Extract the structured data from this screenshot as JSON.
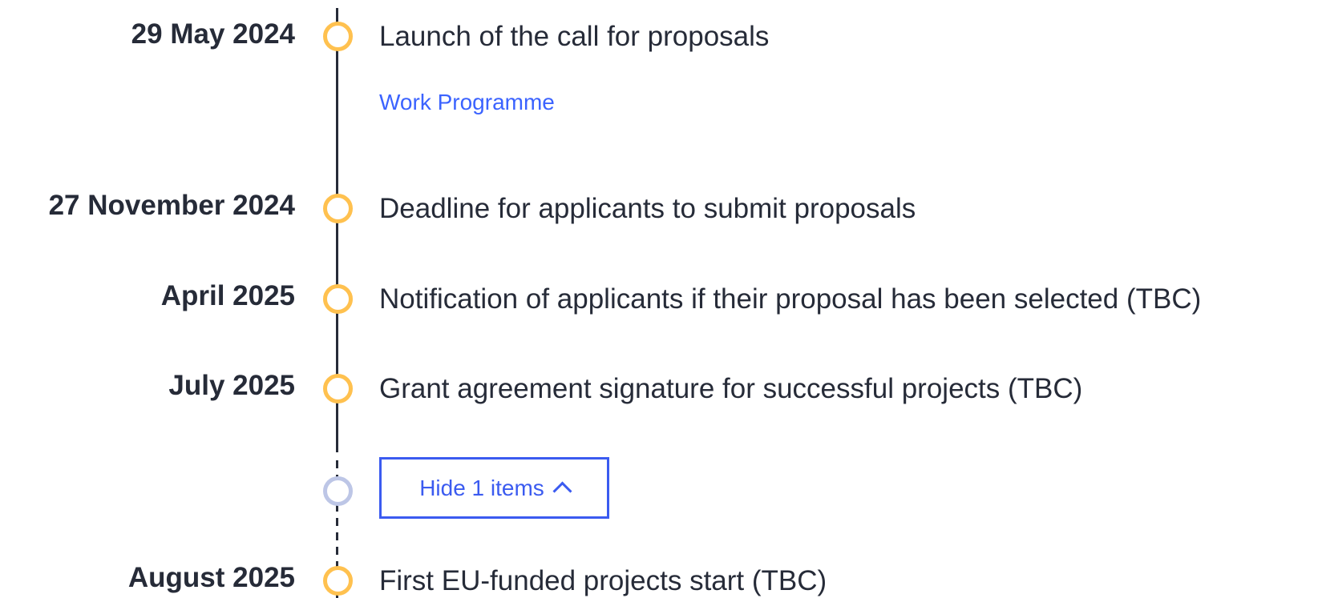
{
  "timeline": {
    "items": [
      {
        "date": "29 May 2024",
        "description": "Launch of the call for proposals",
        "link_label": "Work Programme"
      },
      {
        "date": "27 November 2024",
        "description": "Deadline for applicants to submit proposals"
      },
      {
        "date": "April 2025",
        "description": "Notification of applicants if their proposal has been selected (TBC)"
      },
      {
        "date": "July 2025",
        "description": "Grant agreement signature for successful projects (TBC)"
      },
      {
        "date": "August 2025",
        "description": "First EU-funded projects start (TBC)"
      }
    ],
    "toggle_label": "Hide 1 items",
    "toggle_icon": "chevron-up-icon"
  },
  "colors": {
    "marker": "#ffc14f",
    "marker_muted": "#bdc6e6",
    "link": "#3b63ff",
    "text": "#262b38"
  }
}
